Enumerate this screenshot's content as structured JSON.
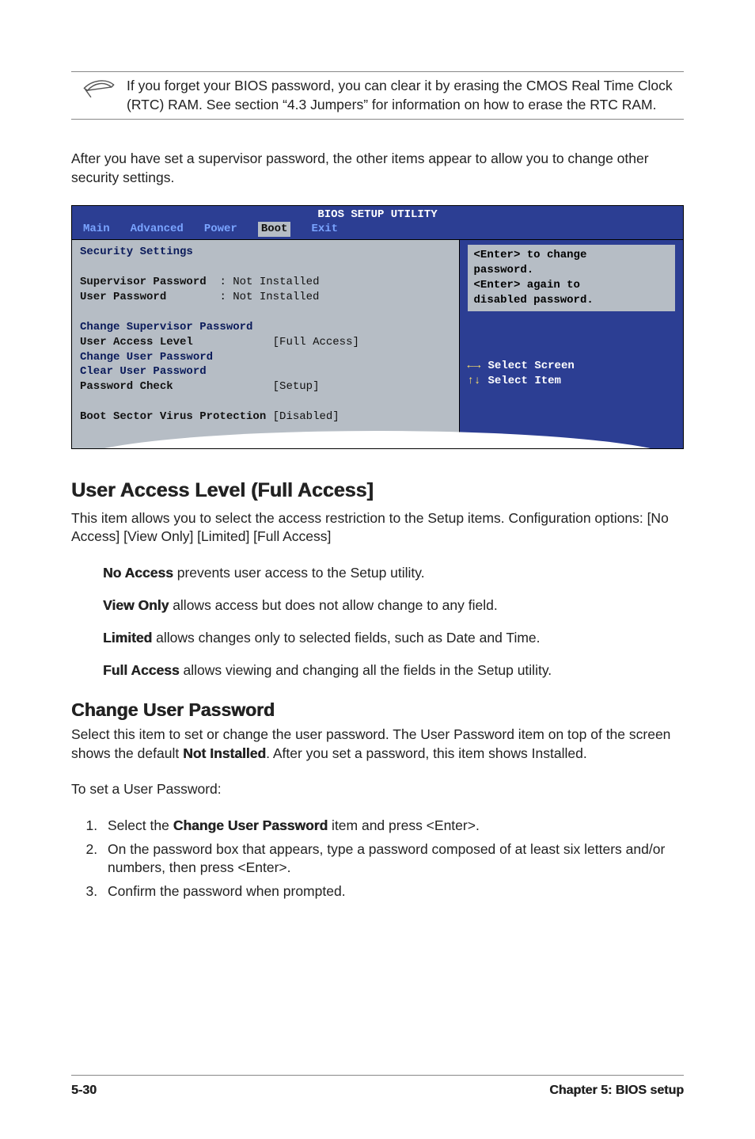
{
  "note": "If you forget your BIOS password, you can clear it by erasing the CMOS Real Time Clock (RTC) RAM. See section “4.3 Jumpers” for information on how to erase the RTC RAM.",
  "intro": "After you have set a supervisor password, the other items appear to allow you to change other security settings.",
  "bios": {
    "title": "BIOS SETUP UTILITY",
    "tabs": [
      "Main",
      "Advanced",
      "Power",
      "Boot",
      "Exit"
    ],
    "active_tab": "Boot",
    "section_title": "Security Settings",
    "rows": {
      "supervisor_label": "Supervisor Password",
      "supervisor_value": ": Not Installed",
      "user_label": "User Password",
      "user_value": ": Not Installed",
      "change_sup": "Change Supervisor Password",
      "ual_label": "User Access Level",
      "ual_value": "[Full Access]",
      "change_user": "Change User Password",
      "clear_user": "Clear User Password",
      "pw_check_label": "Password Check",
      "pw_check_value": "[Setup]",
      "boot_sector_label": "Boot Sector Virus Protection",
      "boot_sector_value": "[Disabled]"
    },
    "help": "<Enter> to change\npassword.\n<Enter> again to\ndisabled password.",
    "keys": [
      {
        "sym": "←→",
        "label": "Select Screen"
      },
      {
        "sym": "↑↓",
        "label": "Select Item"
      }
    ]
  },
  "section_ual": {
    "title": "User Access Level (Full Access]",
    "desc": "This item allows you to select the access restriction to the Setup items. Configuration options: [No Access] [View Only] [Limited] [Full Access]",
    "options": [
      {
        "name": "No Access",
        "desc": " prevents user access to the Setup utility."
      },
      {
        "name": "View Only",
        "desc": " allows access but does not allow change to any field."
      },
      {
        "name": "Limited",
        "desc": " allows changes only to selected fields, such as Date and Time."
      },
      {
        "name": "Full Access",
        "desc": " allows viewing and changing all the fields in the Setup utility."
      }
    ]
  },
  "section_cup": {
    "title": "Change User Password",
    "p1a": "Select this item to set or change the user password. The User Password item on top of the screen shows the default ",
    "p1bold": "Not Installed",
    "p1b": ". After you set a password, this item shows Installed.",
    "p2": "To set a User Password:",
    "steps": [
      {
        "a": "Select the ",
        "b": "Change User Password",
        "c": " item and press <Enter>."
      },
      {
        "a": "On the password box that appears, type a password composed of at least six letters and/or numbers, then press <Enter>.",
        "b": "",
        "c": ""
      },
      {
        "a": "Confirm the password when prompted.",
        "b": "",
        "c": ""
      }
    ]
  },
  "footer": {
    "page": "5-30",
    "chapter": "Chapter 5: BIOS setup"
  }
}
